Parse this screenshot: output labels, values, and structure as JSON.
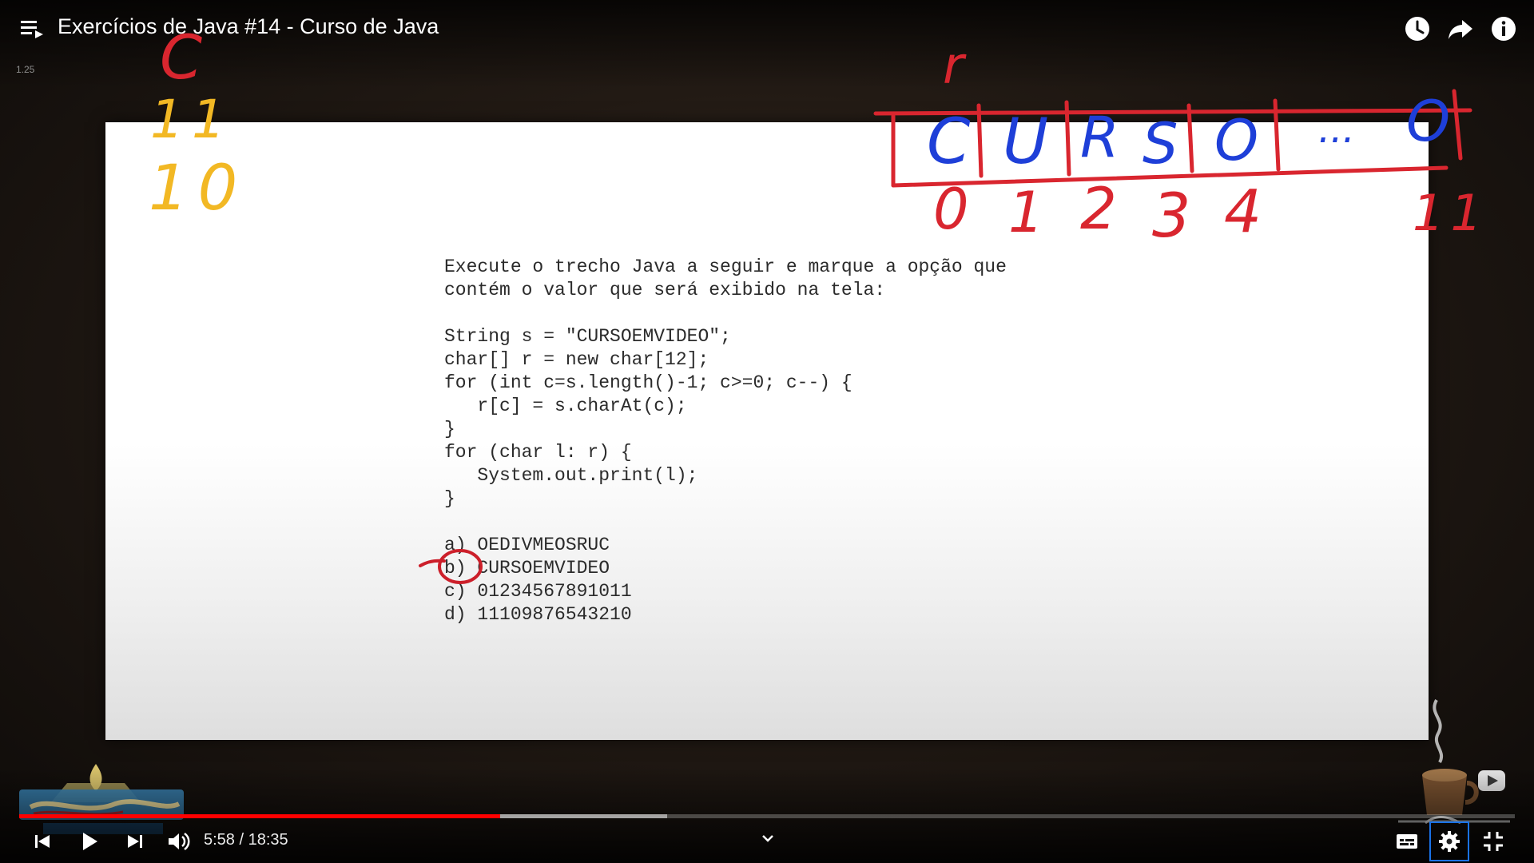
{
  "header": {
    "title": "Exercícios de Java #14 - Curso de Java",
    "speed": "1.25",
    "icons": [
      "playlist-icon",
      "watch-later-icon",
      "share-icon",
      "info-icon"
    ]
  },
  "slide": {
    "question_lines": [
      "Execute o trecho Java a seguir e marque a opção que",
      "contém o valor que será exibido na tela:",
      "",
      "String s = \"CURSOEMVIDEO\";",
      "char[] r = new char[12];",
      "for (int c=s.length()-1; c>=0; c--) {",
      "   r[c] = s.charAt(c);",
      "}",
      "for (char l: r) {",
      "   System.out.print(l);",
      "}",
      "",
      "a) OEDIVMEOSRUC",
      "b) CURSOEMVIDEO",
      "c) 01234567891011",
      "d) 11109876543210"
    ]
  },
  "annotations": {
    "yellow_top": "C",
    "yellow_row1": "11",
    "yellow_row2": "10",
    "red_array_label": "r",
    "array_cells": [
      "C",
      "U",
      "R",
      "S",
      "O",
      "...",
      "O"
    ],
    "array_indices": [
      "0",
      "1",
      "2",
      "3",
      "4",
      "11"
    ],
    "circled_option": "b)"
  },
  "player": {
    "current_time": "5:58",
    "duration": "18:35",
    "time_text": "5:58 / 18:35",
    "played_fraction": 0.3215,
    "buffered_fraction": 0.433,
    "accent_color": "#ff0000",
    "focus_color": "#1a73e8"
  }
}
